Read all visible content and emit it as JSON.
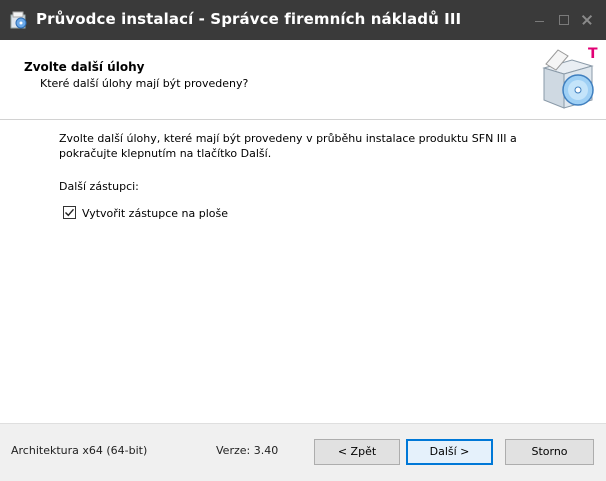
{
  "window": {
    "title": "Průvodce instalací - Správce firemních nákladů III",
    "controls": [
      "minimize",
      "maximize",
      "close"
    ]
  },
  "header": {
    "title": "Zvolte další úlohy",
    "subtitle": "Které další úlohy mají být provedeny?",
    "icon": "setup-box-icon"
  },
  "content": {
    "description_lines": [
      "Zvolte další úlohy, které mají být provedeny v průběhu instalace produktu SFN III a",
      "pokračujte klepnutím na tlačítko Další."
    ],
    "group_label": "Další zástupci:",
    "tasks": [
      {
        "label": "Vytvořit zástupce na ploše",
        "checked": true
      }
    ]
  },
  "footer": {
    "architecture": "Architektura x64 (64-bit)",
    "version": "Verze: 3.40",
    "buttons": {
      "back": "< Zpět",
      "next": "Další >",
      "cancel": "Storno"
    }
  },
  "colors": {
    "titlebar": "#3a3a3a",
    "footer": "#f0f0f0",
    "default_button_border": "#0078d7",
    "brand_t": "#e20074"
  }
}
